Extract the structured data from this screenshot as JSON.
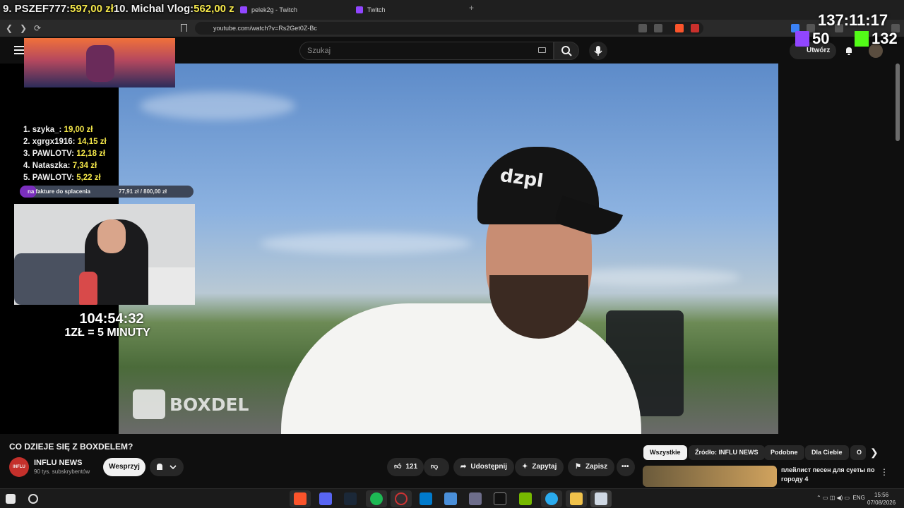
{
  "browser": {
    "tabs": [
      {
        "label": "pelek2g - Twitch"
      },
      {
        "label": "Twitch"
      }
    ],
    "new_tab": "+",
    "url": "youtube.com/watch?v=Rs2Get0Z-Bc"
  },
  "youtube_header": {
    "search_placeholder": "Szukaj",
    "create_label": "Utwórz"
  },
  "stream_overlay": {
    "ticker": [
      {
        "rank": "9. PSZEF777: ",
        "amount": "597,00 zł"
      },
      {
        "rank": "10. Michal Vlog: ",
        "amount": "562,00 z"
      }
    ],
    "big_timer": "137:11:17",
    "viewers": [
      {
        "platform": "twitch",
        "count": "50"
      },
      {
        "platform": "kick",
        "count": "132"
      }
    ],
    "donors": [
      {
        "name": "1. szyka_: ",
        "amount": "19,00 zł"
      },
      {
        "name": "2. xgrgx1916: ",
        "amount": "14,15 zł"
      },
      {
        "name": "3. PAWLOTV: ",
        "amount": "12,18 zł"
      },
      {
        "name": "4. Nataszka: ",
        "amount": "7,34 zł"
      },
      {
        "name": "5. PAWLOTV: ",
        "amount": "5,22 zł"
      }
    ],
    "goal": {
      "label": "na fakture do splacenia",
      "value": "77,91 zł / 800,00 zł",
      "progress_fraction": 0.097
    },
    "subathon_timer": "104:54:32",
    "rate_text": "1ZŁ = 5 MINUTY"
  },
  "video": {
    "cap_logo_text": "dzpl",
    "watermark_text": "BOXDEL"
  },
  "info": {
    "title": "CO DZIEJE SIĘ Z BOXDELEM?",
    "channel_avatar_text": "INFLU",
    "channel_name": "INFLU NEWS",
    "subscribers": "90 tys. subskrybentów",
    "support_label": "Wesprzyj",
    "like_count": "121",
    "share_label": "Udostępnij",
    "ask_label": "Zapytaj",
    "save_label": "Zapisz",
    "chips": [
      "Wszystkie",
      "Źródło: INFLU NEWS",
      "Podobne",
      "Dla Ciebie",
      "O"
    ],
    "recommendation_title": "плейлист песен для суеты по городу 4"
  },
  "taskbar": {
    "language": "ENG",
    "time": "15:56",
    "date": "07/08/2026"
  }
}
